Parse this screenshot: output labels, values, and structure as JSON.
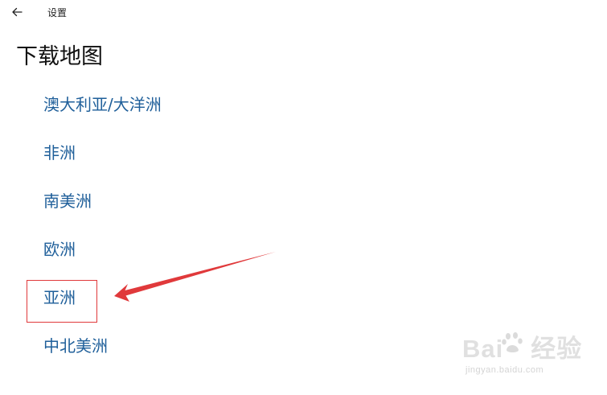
{
  "window": {
    "title": "设置",
    "back_icon": "arrow-left-icon"
  },
  "page": {
    "title": "下载地图"
  },
  "regions": [
    {
      "label": "澳大利亚/大洋洲"
    },
    {
      "label": "非洲"
    },
    {
      "label": "南美洲"
    },
    {
      "label": "欧洲"
    },
    {
      "label": "亚洲"
    },
    {
      "label": "中北美洲"
    }
  ],
  "annotation": {
    "highlighted_region": "亚洲",
    "color": "#e0393b"
  },
  "colors": {
    "link": "#1f5f9a",
    "title": "#111111",
    "background": "#ffffff"
  },
  "watermark": {
    "brand_pre": "Bai",
    "brand_post": "经验",
    "url": "jingyan.baidu.com",
    "icon": "baidu-paw-icon"
  }
}
